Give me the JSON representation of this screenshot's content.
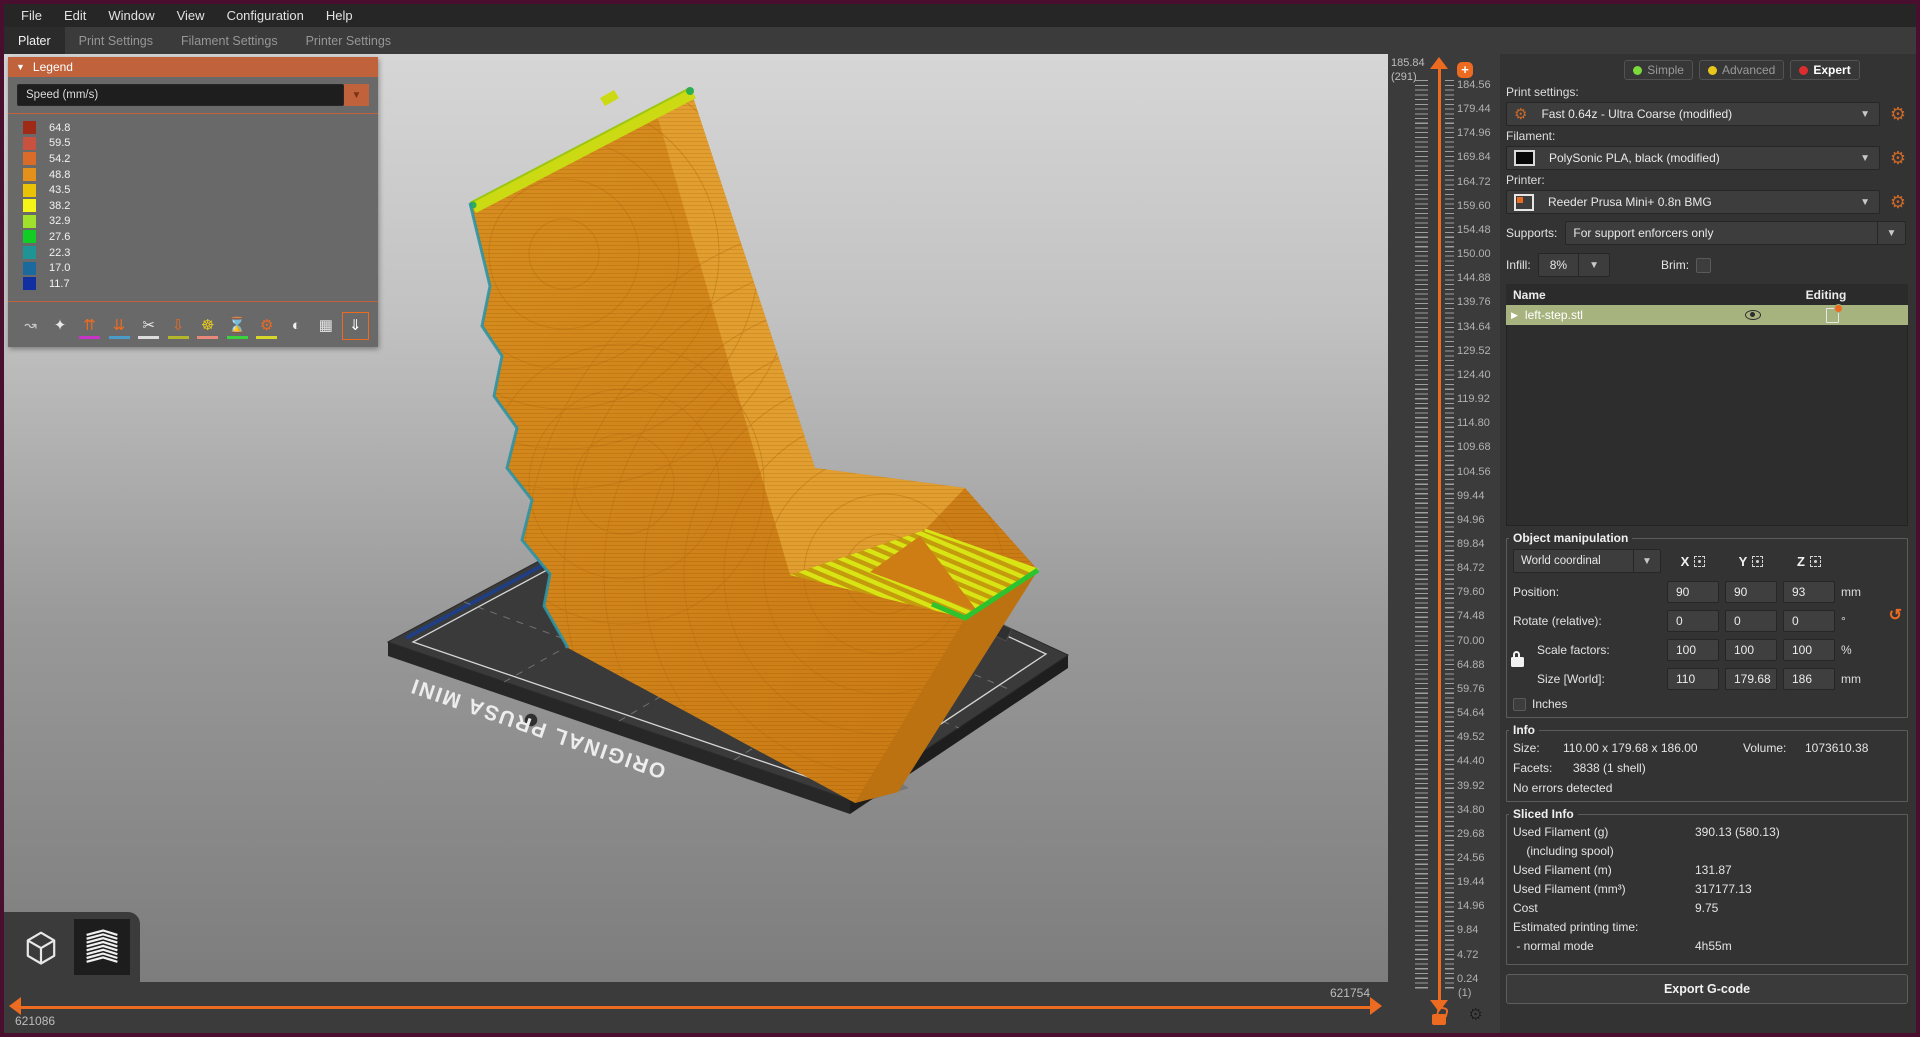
{
  "menu_bar": {
    "items": [
      {
        "label": "File"
      },
      {
        "label": "Edit"
      },
      {
        "label": "Window"
      },
      {
        "label": "View"
      },
      {
        "label": "Configuration"
      },
      {
        "label": "Help"
      }
    ]
  },
  "tab_bar": {
    "tabs": [
      {
        "label": "Plater"
      },
      {
        "label": "Print Settings"
      },
      {
        "label": "Filament Settings"
      },
      {
        "label": "Printer Settings"
      }
    ]
  },
  "legend": {
    "title": "Legend",
    "view_type": "Speed (mm/s)",
    "entries": [
      {
        "value": "64.8",
        "color": "#9F2A17"
      },
      {
        "value": "59.5",
        "color": "#C8523F"
      },
      {
        "value": "54.2",
        "color": "#DA6B28"
      },
      {
        "value": "48.8",
        "color": "#E4911C"
      },
      {
        "value": "43.5",
        "color": "#EAC307"
      },
      {
        "value": "38.2",
        "color": "#F5F618"
      },
      {
        "value": "32.9",
        "color": "#A0E22B"
      },
      {
        "value": "27.6",
        "color": "#12CD23"
      },
      {
        "value": "22.3",
        "color": "#1E9594"
      },
      {
        "value": "17.0",
        "color": "#1C699E"
      },
      {
        "value": "11.7",
        "color": "#122FA2"
      }
    ],
    "toolbar": [
      {
        "name": "travel-moves-icon",
        "glyph": "↝",
        "color": "#c8c8c8",
        "underline": "transparent",
        "border": "transparent"
      },
      {
        "name": "wipe-moves-icon",
        "glyph": "✦",
        "color": "#e8e8e8",
        "underline": "transparent",
        "border": "transparent"
      },
      {
        "name": "retractions-icon",
        "glyph": "⇈",
        "color": "#ED6B21",
        "underline": "#C735C7",
        "border": "transparent"
      },
      {
        "name": "deretractions-icon",
        "glyph": "⇊",
        "color": "#ED6B21",
        "underline": "#4A9DC9",
        "border": "transparent"
      },
      {
        "name": "seams-icon",
        "glyph": "✂",
        "color": "#e8e8e8",
        "underline": "#DCDCDC",
        "border": "transparent"
      },
      {
        "name": "tool-changes-icon",
        "glyph": "⇩",
        "color": "#ED6B21",
        "underline": "#B5B52B",
        "border": "transparent"
      },
      {
        "name": "color-changes-icon",
        "glyph": "☸",
        "color": "#E8C71D",
        "underline": "#E8887A",
        "border": "transparent"
      },
      {
        "name": "pause-prints-icon",
        "glyph": "⌛",
        "color": "#e8e8e8",
        "underline": "#3BD23B",
        "border": "transparent"
      },
      {
        "name": "custom-gcodes-icon",
        "glyph": "⚙",
        "color": "#ED6B21",
        "underline": "#D7D72B",
        "border": "transparent"
      },
      {
        "name": "center-of-gravity-icon",
        "glyph": "◐",
        "color": "#f2f2f2",
        "underline": "transparent",
        "border": "transparent"
      },
      {
        "name": "shells-icon",
        "glyph": "▦",
        "color": "#e8e8e8",
        "underline": "transparent",
        "border": "transparent"
      },
      {
        "name": "legend-toggle-icon",
        "glyph": "⇓",
        "color": "#ffffff",
        "underline": "transparent",
        "border": "#ED6B21"
      }
    ]
  },
  "viewport": {
    "bed_text": "ORIGINAL PRUSA MINI"
  },
  "layer_slider": {
    "top_value": "185.84",
    "top_count": "(291)",
    "bottom_count": "(1)",
    "plus_label": "+",
    "ticks": [
      "184.56",
      "179.44",
      "174.96",
      "169.84",
      "164.72",
      "159.60",
      "154.48",
      "150.00",
      "144.88",
      "139.76",
      "134.64",
      "129.52",
      "124.40",
      "119.92",
      "114.80",
      "109.68",
      "104.56",
      "99.44",
      "94.96",
      "89.84",
      "84.72",
      "79.60",
      "74.48",
      "70.00",
      "64.88",
      "59.76",
      "54.64",
      "49.52",
      "44.40",
      "39.92",
      "34.80",
      "29.68",
      "24.56",
      "19.44",
      "14.96",
      "9.84",
      "4.72",
      "0.24"
    ]
  },
  "horizontal_slider": {
    "left_value": "621086",
    "right_value": "621754"
  },
  "panel": {
    "modes": [
      {
        "label": "Simple",
        "color": "#7CDA3A"
      },
      {
        "label": "Advanced",
        "color": "#E8C71D"
      },
      {
        "label": "Expert",
        "color": "#DC2E2E"
      }
    ],
    "print_settings_label": "Print settings:",
    "print_settings_value": "Fast 0.64z - Ultra Coarse (modified)",
    "filament_label": "Filament:",
    "filament_value": "PolySonic PLA, black (modified)",
    "printer_label": "Printer:",
    "printer_value": "Reeder Prusa Mini+ 0.8n BMG",
    "supports_label": "Supports:",
    "supports_value": "For support enforcers only",
    "infill_label": "Infill:",
    "infill_value": "8%",
    "brim_label": "Brim:",
    "object_list": {
      "col_name": "Name",
      "col_editing": "Editing",
      "rows": [
        {
          "name": "left-step.stl"
        }
      ]
    },
    "manipulation": {
      "title": "Object manipulation",
      "coord_system": "World coordinal",
      "axis_x": "X",
      "axis_y": "Y",
      "axis_z": "Z",
      "rows": [
        {
          "label": "Position:",
          "x": "90",
          "y": "90",
          "z": "93",
          "unit": "mm"
        },
        {
          "label": "Rotate (relative):",
          "x": "0",
          "y": "0",
          "z": "0",
          "unit": "°"
        },
        {
          "label": "Scale factors:",
          "x": "100",
          "y": "100",
          "z": "100",
          "unit": "%"
        },
        {
          "label": "Size [World]:",
          "x": "110",
          "y": "179.68",
          "z": "186",
          "unit": "mm"
        }
      ],
      "inches_label": "Inches"
    },
    "info": {
      "title": "Info",
      "size_label": "Size:",
      "size_value": "110.00 x 179.68 x 186.00",
      "volume_label": "Volume:",
      "volume_value": "1073610.38",
      "facets_label": "Facets:",
      "facets_value": "3838 (1 shell)",
      "errors": "No errors detected"
    },
    "sliced_info": {
      "title": "Sliced Info",
      "rows": [
        {
          "label": "Used Filament (g)",
          "value": "390.13 (580.13)"
        },
        {
          "label": "    (including spool)",
          "value": ""
        },
        {
          "label": "Used Filament (m)",
          "value": "131.87"
        },
        {
          "label": "Used Filament (mm³)",
          "value": "317177.13"
        },
        {
          "label": "Cost",
          "value": "9.75"
        },
        {
          "label": "Estimated printing time:",
          "value": ""
        },
        {
          "label": " - normal mode",
          "value": "4h55m"
        }
      ]
    },
    "export_label": "Export G-code"
  }
}
